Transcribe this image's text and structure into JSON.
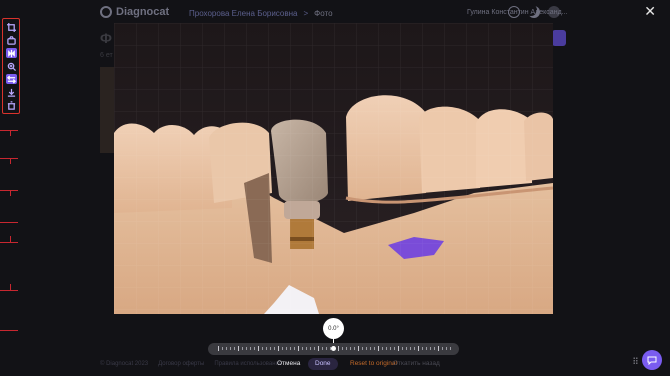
{
  "app": {
    "logo_text": "Diagnocat",
    "breadcrumb_patient": "Прохорова Елена Борисовна",
    "breadcrumb_sep": ">",
    "breadcrumb_page": "Фото",
    "user_name": "Гулина Константин Александ...",
    "page_title_partial": "Ф",
    "page_subtitle_partial": "6 ет",
    "footer_copyright": "© Diagnocat 2023",
    "footer_link_1": "Договор оферты",
    "footer_link_2": "Правила использования"
  },
  "toolbar": {
    "items": [
      {
        "name": "crop-icon",
        "active": false
      },
      {
        "name": "camera-rotate-icon",
        "active": false
      },
      {
        "name": "flip-icon",
        "active": true
      },
      {
        "name": "zoom-icon",
        "active": false
      },
      {
        "name": "compare-icon",
        "active": true
      },
      {
        "name": "download-icon",
        "active": false
      },
      {
        "name": "trash-icon",
        "active": false
      }
    ]
  },
  "rotation": {
    "angle_label": "0.0°",
    "angle_value": 0.0
  },
  "actions": {
    "cancel": "Отмена",
    "done": "Done",
    "reset": "Reset to original",
    "faded": "Откатить назад"
  },
  "colors": {
    "accent": "#7a5cf0",
    "toolbar_border": "#d9332c",
    "reset_text": "#c36a2a"
  }
}
